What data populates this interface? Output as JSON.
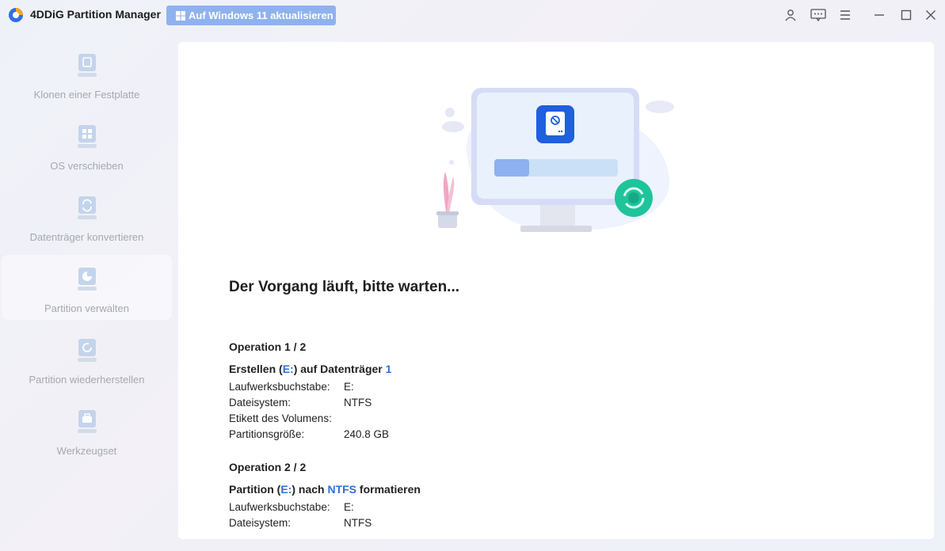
{
  "app": {
    "title": "4DDiG Partition Manager",
    "upgrade_label": "Auf Windows 11 aktualisieren",
    "icons": [
      "account-icon",
      "feedback-icon",
      "menu-icon",
      "minimize-icon",
      "maximize-icon",
      "close-icon"
    ]
  },
  "sidebar": {
    "items": [
      {
        "label": "Klonen einer Festplatte",
        "icon": "clone-disk-icon",
        "active": false
      },
      {
        "label": "OS verschieben",
        "icon": "os-migrate-icon",
        "active": false
      },
      {
        "label": "Datenträger konvertieren",
        "icon": "convert-disk-icon",
        "active": false
      },
      {
        "label": "Partition verwalten",
        "icon": "partition-manage-icon",
        "active": true
      },
      {
        "label": "Partition wiederherstellen",
        "icon": "partition-restore-icon",
        "active": false
      },
      {
        "label": "Werkzeugset",
        "icon": "toolkit-icon",
        "active": false
      }
    ]
  },
  "main": {
    "status": "Der Vorgang läuft, bitte warten...",
    "operations": [
      {
        "title": "Operation 1 / 2",
        "desc_parts": [
          "Erstellen (",
          "E:",
          ") auf Datenträger ",
          "1"
        ],
        "rows": [
          {
            "key": "Laufwerksbuchstabe:",
            "value": "E:"
          },
          {
            "key": "Dateisystem:",
            "value": "NTFS"
          },
          {
            "key": "Etikett des Volumens:",
            "value": ""
          },
          {
            "key": "Partitionsgröße:",
            "value": "240.8 GB"
          }
        ]
      },
      {
        "title": "Operation 2 / 2",
        "desc_parts": [
          "Partition (",
          "E:",
          ") nach ",
          "NTFS",
          " formatieren"
        ],
        "rows": [
          {
            "key": "Laufwerksbuchstabe:",
            "value": "E:"
          },
          {
            "key": "Dateisystem:",
            "value": "NTFS"
          }
        ]
      }
    ]
  },
  "colors": {
    "accent": "#2e6fd8",
    "upgrade_bg": "#8fb2ef",
    "sidebar_text": "#a3a8b2",
    "progress_ring": "#1fc49a"
  }
}
